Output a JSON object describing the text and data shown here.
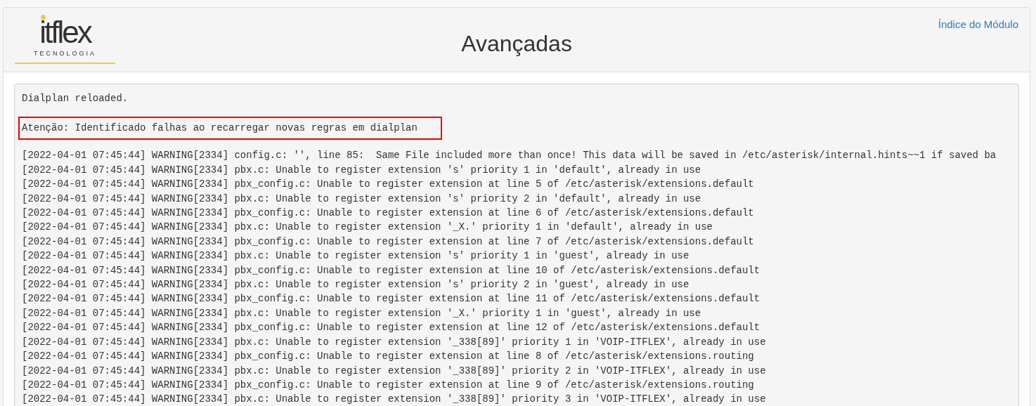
{
  "header": {
    "logo": {
      "wordmark": "itflex",
      "tagline": "TECNOLOGIA"
    },
    "title": "Avançadas",
    "link": "Índice do Módulo"
  },
  "output": {
    "status": "Dialplan reloaded.",
    "alert": "Atenção: Identificado falhas ao recarregar novas regras em dialplan",
    "log_lines": [
      "[2022-04-01 07:45:44] WARNING[2334] config.c: '', line 85:  Same File included more than once! This data will be saved in /etc/asterisk/internal.hints~~1 if saved ba",
      "[2022-04-01 07:45:44] WARNING[2334] pbx.c: Unable to register extension 's' priority 1 in 'default', already in use",
      "[2022-04-01 07:45:44] WARNING[2334] pbx_config.c: Unable to register extension at line 5 of /etc/asterisk/extensions.default",
      "[2022-04-01 07:45:44] WARNING[2334] pbx.c: Unable to register extension 's' priority 2 in 'default', already in use",
      "[2022-04-01 07:45:44] WARNING[2334] pbx_config.c: Unable to register extension at line 6 of /etc/asterisk/extensions.default",
      "[2022-04-01 07:45:44] WARNING[2334] pbx.c: Unable to register extension '_X.' priority 1 in 'default', already in use",
      "[2022-04-01 07:45:44] WARNING[2334] pbx_config.c: Unable to register extension at line 7 of /etc/asterisk/extensions.default",
      "[2022-04-01 07:45:44] WARNING[2334] pbx.c: Unable to register extension 's' priority 1 in 'guest', already in use",
      "[2022-04-01 07:45:44] WARNING[2334] pbx_config.c: Unable to register extension at line 10 of /etc/asterisk/extensions.default",
      "[2022-04-01 07:45:44] WARNING[2334] pbx.c: Unable to register extension 's' priority 2 in 'guest', already in use",
      "[2022-04-01 07:45:44] WARNING[2334] pbx_config.c: Unable to register extension at line 11 of /etc/asterisk/extensions.default",
      "[2022-04-01 07:45:44] WARNING[2334] pbx.c: Unable to register extension '_X.' priority 1 in 'guest', already in use",
      "[2022-04-01 07:45:44] WARNING[2334] pbx_config.c: Unable to register extension at line 12 of /etc/asterisk/extensions.default",
      "[2022-04-01 07:45:44] WARNING[2334] pbx.c: Unable to register extension '_338[89]' priority 1 in 'VOIP-ITFLEX', already in use",
      "[2022-04-01 07:45:44] WARNING[2334] pbx_config.c: Unable to register extension at line 8 of /etc/asterisk/extensions.routing",
      "[2022-04-01 07:45:44] WARNING[2334] pbx.c: Unable to register extension '_338[89]' priority 2 in 'VOIP-ITFLEX', already in use",
      "[2022-04-01 07:45:44] WARNING[2334] pbx_config.c: Unable to register extension at line 9 of /etc/asterisk/extensions.routing",
      "[2022-04-01 07:45:44] WARNING[2334] pbx.c: Unable to register extension '_338[89]' priority 3 in 'VOIP-ITFLEX', already in use"
    ]
  }
}
